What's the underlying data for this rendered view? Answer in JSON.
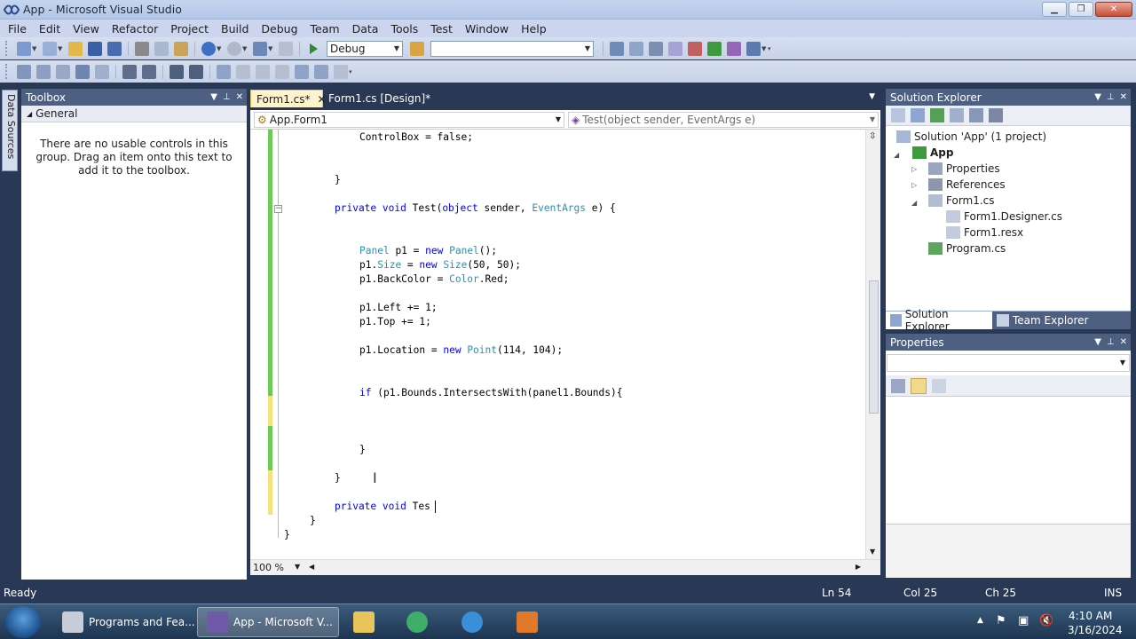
{
  "window": {
    "title": "App - Microsoft Visual Studio"
  },
  "menu": [
    "File",
    "Edit",
    "View",
    "Refactor",
    "Project",
    "Build",
    "Debug",
    "Team",
    "Data",
    "Tools",
    "Test",
    "Window",
    "Help"
  ],
  "toolbar": {
    "config": "Debug",
    "platform": ""
  },
  "left_tabs": {
    "data_sources": "Data Sources"
  },
  "toolbox": {
    "title": "Toolbox",
    "group": "General",
    "empty_message": "There are no usable controls in this group. Drag an item onto this text to add it to the toolbox."
  },
  "editor": {
    "tabs": [
      {
        "label": "Form1.cs*"
      },
      {
        "label": "Form1.cs [Design]*"
      }
    ],
    "class_combo": "App.Form1",
    "member_combo": "Test(object sender, EventArgs e)",
    "zoom": "100 %",
    "lines": [
      {
        "text": "ControlBox = false;"
      },
      {
        "text": "}"
      },
      {
        "text": "private void Test(object sender, EventArgs e) {"
      },
      {
        "text": "Panel p1 = new Panel();"
      },
      {
        "text": "p1.Size = new Size(50, 50);"
      },
      {
        "text": "p1.BackColor = Color.Red;"
      },
      {
        "text": "p1.Left += 1;"
      },
      {
        "text": "p1.Top += 1;"
      },
      {
        "text": "p1.Location = new Point(114, 104);"
      },
      {
        "text": "if (p1.Bounds.IntersectsWith(panel1.Bounds){"
      },
      {
        "text": "}"
      },
      {
        "text": "}"
      },
      {
        "text": "private void Tes"
      },
      {
        "text": "}"
      },
      {
        "text": "}"
      }
    ]
  },
  "solution_explorer": {
    "title": "Solution Explorer",
    "tree": [
      {
        "label": "Solution 'App' (1 project)"
      },
      {
        "label": "App"
      },
      {
        "label": "Properties"
      },
      {
        "label": "References"
      },
      {
        "label": "Form1.cs"
      },
      {
        "label": "Form1.Designer.cs"
      },
      {
        "label": "Form1.resx"
      },
      {
        "label": "Program.cs"
      }
    ],
    "tabs": [
      "Solution Explorer",
      "Team Explorer"
    ]
  },
  "properties": {
    "title": "Properties"
  },
  "status": {
    "text": "Ready",
    "ln": "Ln 54",
    "col": "Col 25",
    "ch": "Ch 25",
    "mode": "INS"
  },
  "taskbar": {
    "tasks": [
      "Programs and Fea...",
      "App - Microsoft V..."
    ],
    "time": "4:10 AM",
    "date": "3/16/2024"
  },
  "colors": {
    "keyword": "#0000ff",
    "type": "#2b91af",
    "chrome": "#293955",
    "panel_header": "#4d6082"
  }
}
